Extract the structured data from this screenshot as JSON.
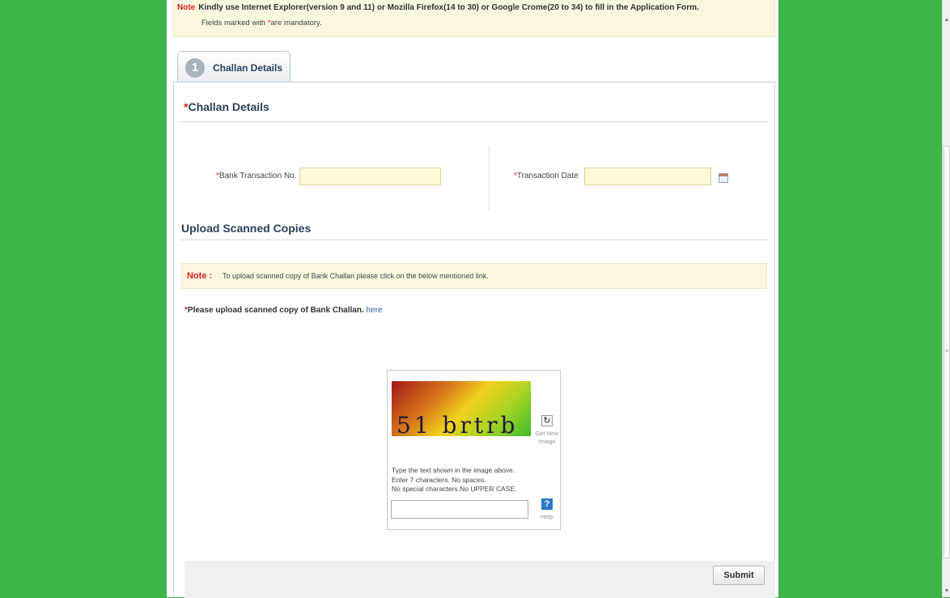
{
  "note": {
    "label": "Note",
    "text": "Kindly use Internet Explorer(version 9 and 11) or Mozilla Firefox(14 to 30) or Google Crome(20 to 34) to fill in the Application Form.",
    "mandatory_prefix": "Fields marked with ",
    "mandatory_star": "*",
    "mandatory_suffix": "are mandatory."
  },
  "tab": {
    "number": "1",
    "label": "Challan Details"
  },
  "challan_section": {
    "star": "*",
    "title": "Challan Details"
  },
  "fields": {
    "bank_transaction": {
      "star": "*",
      "label": "Bank Transaction No.",
      "value": ""
    },
    "transaction_date": {
      "star": "*",
      "label": "Transaction Date",
      "value": ""
    }
  },
  "upload_section": {
    "title": "Upload Scanned Copies"
  },
  "upload_note": {
    "label": "Note :",
    "text": "To upload scanned copy of Bank Challan please click on the below mentioned link."
  },
  "upload_line": {
    "star": "*",
    "text": "Please upload scanned copy of Bank Challan.",
    "link": "here"
  },
  "captcha": {
    "text": "51 brtrb",
    "refresh_label": "Get New Image",
    "instruction1": "Type the text shown in the image above.",
    "instruction2": "Enter 7 characters. No spaces.",
    "instruction3": "No special characters.No UPPER CASE.",
    "help_label": "Help",
    "input_value": ""
  },
  "submit_label": "Submit",
  "icons": {
    "calendar": "calendar-icon",
    "refresh": "refresh-icon",
    "help": "help-icon"
  },
  "colors": {
    "background": "#3db54a",
    "note_bg": "#faf7de",
    "required": "#d22222",
    "link": "#2a62a8"
  }
}
